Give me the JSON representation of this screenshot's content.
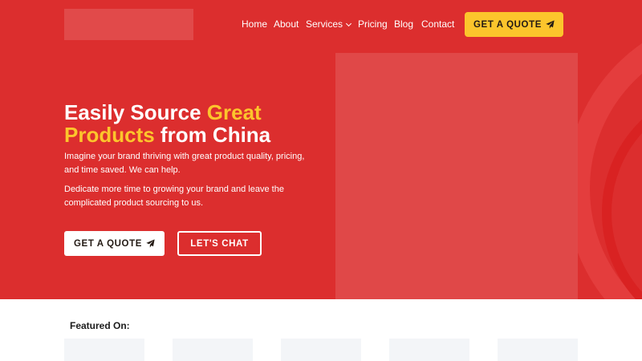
{
  "nav": {
    "items": [
      "Home",
      "About",
      "Services",
      "Pricing",
      "Blog",
      "Contact"
    ],
    "quote_label": "GET A QUOTE"
  },
  "hero": {
    "headline_part1": "Easily Source ",
    "headline_accent1": "Great",
    "headline_accent2": "Products",
    "headline_part2": " from China",
    "paragraph1": "Imagine your brand thriving with great product quality, pricing, and time saved. We can help.",
    "paragraph2": "Dedicate more time to growing your brand and leave the complicated product sourcing to us.",
    "cta_primary": "GET A QUOTE",
    "cta_secondary": "LET'S CHAT"
  },
  "featured": {
    "title": "Featured On:",
    "logo_count": 5
  },
  "colors": {
    "brand_red": "#dc2e2e",
    "accent_yellow": "#fcc52c",
    "text_dark": "#231a14"
  },
  "icons": {
    "quote": "paper-plane-icon",
    "dropdown": "chevron-down-icon"
  }
}
